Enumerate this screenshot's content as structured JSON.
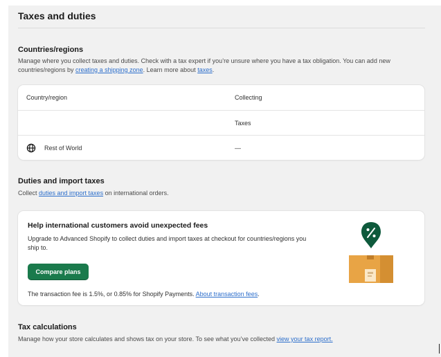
{
  "page": {
    "title": "Taxes and duties"
  },
  "countries": {
    "heading": "Countries/regions",
    "desc_1": "Manage where you collect taxes and duties. Check with a tax expert if you’re unsure where you have a tax obligation. You can add new countries/regions by ",
    "link_shipping_zone": "creating a shipping zone",
    "desc_2": ". Learn more about ",
    "link_taxes": "taxes",
    "desc_3": ".",
    "table": {
      "header_country": "Country/region",
      "header_collecting": "Collecting",
      "rows": [
        {
          "country": "",
          "collecting": "Taxes"
        },
        {
          "country": "Rest of World",
          "collecting": "—",
          "icon": "globe-icon"
        }
      ]
    }
  },
  "duties": {
    "heading": "Duties and import taxes",
    "desc_1": "Collect ",
    "link_duties": "duties and import taxes",
    "desc_2": " on international orders.",
    "promo": {
      "title": "Help international customers avoid unexpected fees",
      "desc": "Upgrade to Advanced Shopify to collect duties and import taxes at checkout for countries/regions you ship to.",
      "button": "Compare plans",
      "fee_text": "The transaction fee is 1.5%, or 0.85% for Shopify Payments. ",
      "fee_link": "About transaction fees",
      "fee_end": ".",
      "illustration": "percent-pin-package-icon"
    }
  },
  "tax_calc": {
    "heading": "Tax calculations",
    "desc": "Manage how your store calculates and shows tax on your store. To see what you’ve collected ",
    "link": "view your tax report."
  },
  "colors": {
    "primary_button": "#1a7a4c",
    "link": "#2c6ecb",
    "pin": "#0e5a3c",
    "box": "#e8a445"
  }
}
